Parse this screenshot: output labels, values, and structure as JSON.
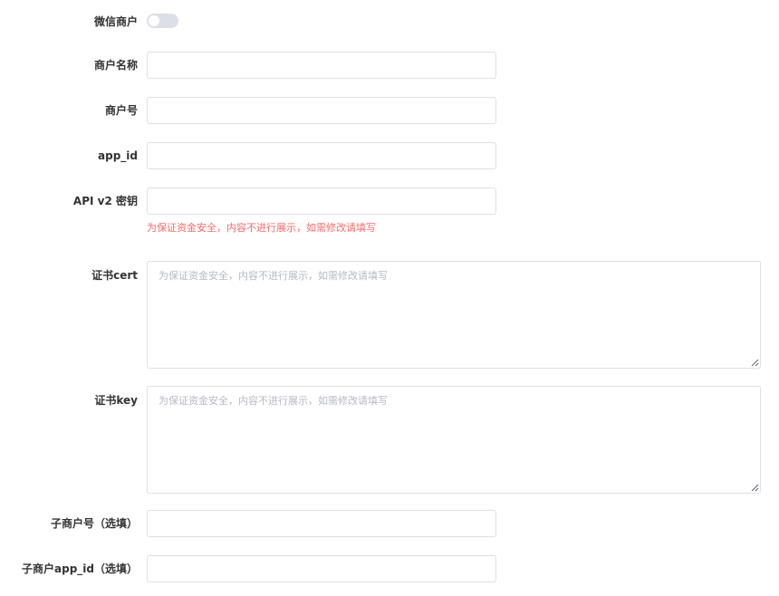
{
  "form": {
    "wechat_merchant": {
      "label": "微信商户",
      "enabled": false
    },
    "merchant_name": {
      "label": "商户名称",
      "value": "",
      "placeholder": ""
    },
    "merchant_no": {
      "label": "商户号",
      "value": "",
      "placeholder": ""
    },
    "app_id": {
      "label": "app_id",
      "value": "",
      "placeholder": ""
    },
    "api_v2_key": {
      "label": "API v2 密钥",
      "value": "",
      "placeholder": "",
      "hint": "为保证资金安全，内容不进行展示，如需修改请填写"
    },
    "cert": {
      "label": "证书cert",
      "value": "",
      "placeholder": "为保证资金安全，内容不进行展示，如需修改请填写"
    },
    "key": {
      "label": "证书key",
      "value": "",
      "placeholder": "为保证资金安全，内容不进行展示，如需修改请填写"
    },
    "sub_merchant_no": {
      "label": "子商户号（选填）",
      "value": "",
      "placeholder": ""
    },
    "sub_app_id": {
      "label": "子商户app_id（选填）",
      "value": "",
      "placeholder": ""
    }
  },
  "colors": {
    "border": "#dcdfe6",
    "toggle_off": "#dcdfe6",
    "hint": "#f56c6c",
    "placeholder": "#b6b9bf"
  }
}
